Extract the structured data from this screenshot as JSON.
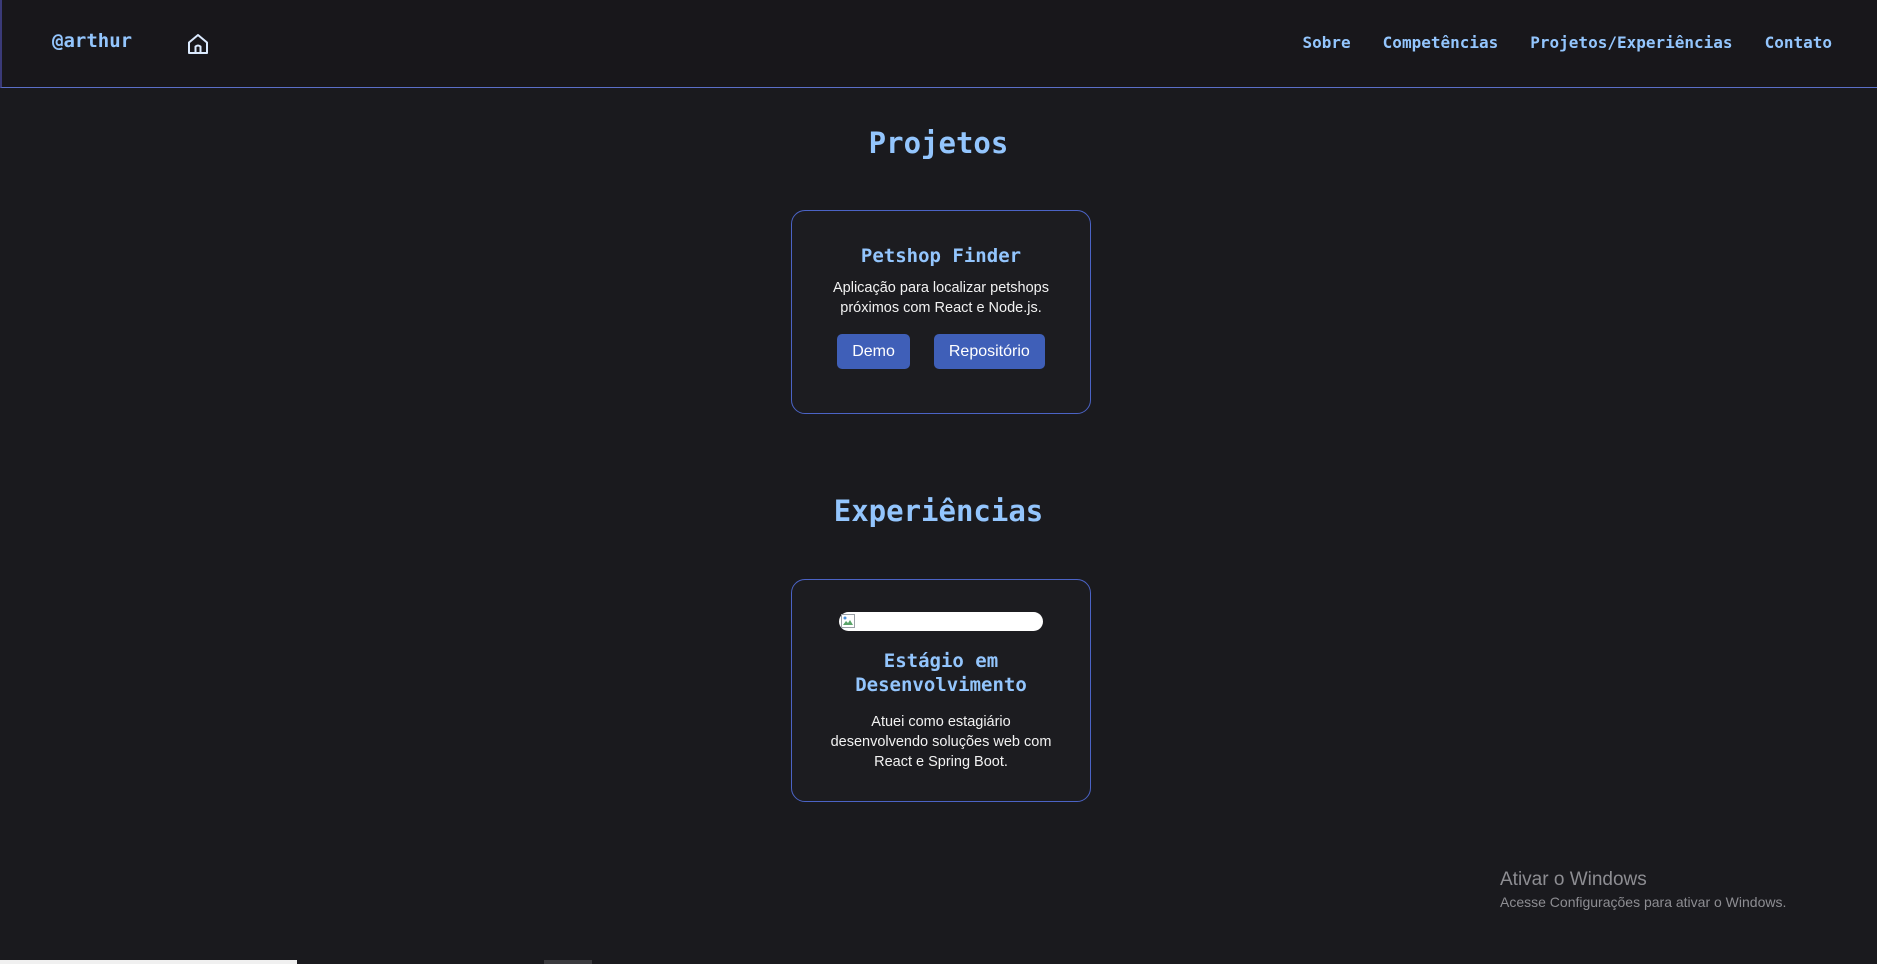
{
  "header": {
    "brand": "@arthur",
    "home_icon": "home-icon",
    "nav": [
      {
        "label": "Sobre"
      },
      {
        "label": "Competências"
      },
      {
        "label": "Projetos/Experiências"
      },
      {
        "label": "Contato"
      }
    ]
  },
  "projects": {
    "title": "Projetos",
    "items": [
      {
        "title": "Petshop Finder",
        "description": "Aplicação para localizar petshops próximos com React e Node.js.",
        "demo_label": "Demo",
        "repo_label": "Repositório"
      }
    ]
  },
  "experiences": {
    "title": "Experiências",
    "items": [
      {
        "image_icon": "broken-image-icon",
        "title": "Estágio em Desenvolvimento",
        "description": "Atuei como estagiário desenvolvendo soluções web com React e Spring Boot."
      }
    ]
  },
  "watermark": {
    "title": "Ativar o Windows",
    "subtitle": "Acesse Configurações para ativar o Windows."
  },
  "colors": {
    "background": "#1a1a1e",
    "accent": "#93c5fd",
    "button": "#3f5fb8",
    "card_border": "#4b63c5"
  }
}
